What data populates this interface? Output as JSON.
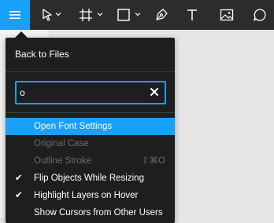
{
  "toolbar": {
    "icons": [
      "hamburger-menu-icon",
      "move-tool-icon",
      "frame-tool-icon",
      "rectangle-tool-icon",
      "pen-tool-icon",
      "text-tool-icon",
      "image-tool-icon",
      "comment-tool-icon"
    ],
    "accent": "#18a0fb",
    "background": "#2c2c2c"
  },
  "menu": {
    "back_label": "Back to Files",
    "search": {
      "value": "o",
      "placeholder": ""
    },
    "items": [
      {
        "label": "Open Font Settings",
        "state": "highlighted",
        "checked": false,
        "shortcut": ""
      },
      {
        "label": "Original Case",
        "state": "disabled",
        "checked": false,
        "shortcut": ""
      },
      {
        "label": "Outline Stroke",
        "state": "disabled",
        "checked": false,
        "shortcut": "⇧⌘O"
      },
      {
        "label": "Flip Objects While Resizing",
        "state": "enabled",
        "checked": true,
        "shortcut": ""
      },
      {
        "label": "Highlight Layers on Hover",
        "state": "enabled",
        "checked": true,
        "shortcut": ""
      },
      {
        "label": "Show Cursors from Other Users",
        "state": "enabled",
        "checked": false,
        "shortcut": ""
      }
    ],
    "check_glyph": "✔"
  }
}
